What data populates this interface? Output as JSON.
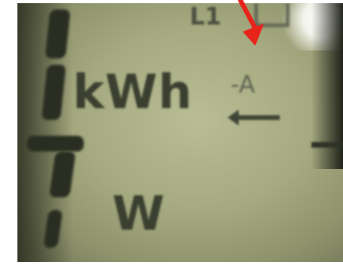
{
  "display": {
    "unit_energy": "kWh",
    "unit_power": "W",
    "phase_label": "L1",
    "direction_label": "-A"
  },
  "colors": {
    "lcd_background": "#a6aa80",
    "segment": "#2a2e22",
    "annotation_arrow": "#e8231a"
  },
  "icons": {
    "annotation": "red-arrow-icon",
    "direction": "left-arrow-icon"
  }
}
